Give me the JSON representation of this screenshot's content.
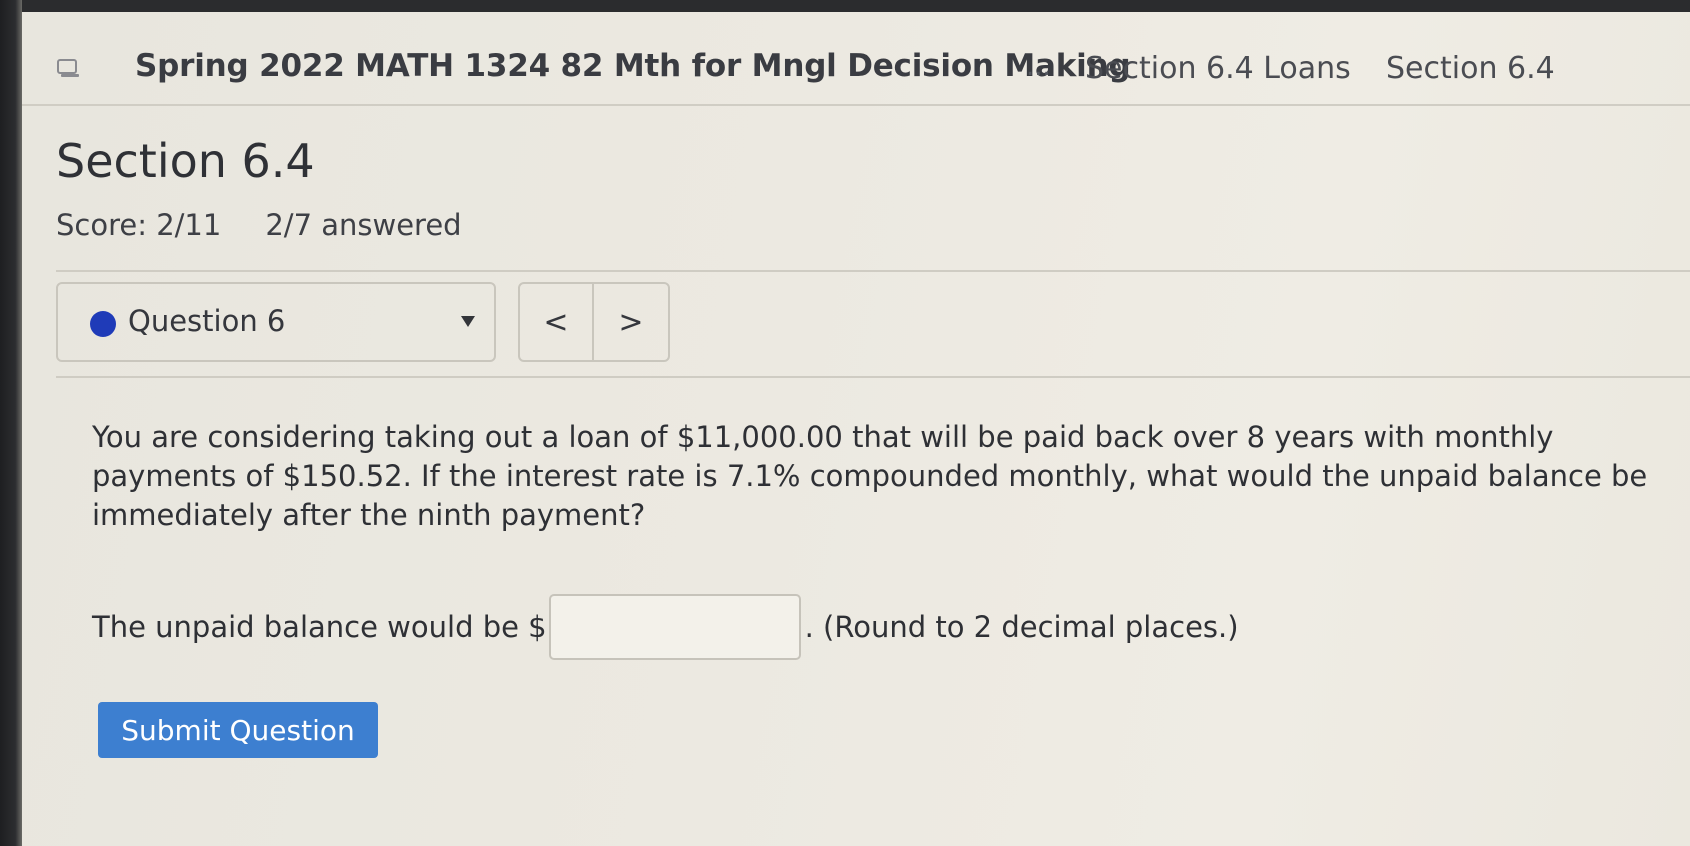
{
  "breadcrumb": {
    "course": "Spring 2022 MATH 1324 82 Mth for Mngl Decision Making",
    "ellipsis": "...",
    "item1": "Section 6.4 Loans",
    "item2": "Section 6.4"
  },
  "section": {
    "title": "Section 6.4",
    "score": "Score: 2/11",
    "answered": "2/7 answered"
  },
  "question_nav": {
    "current": "Question 6",
    "status_color": "#1f3bb8",
    "prev_symbol": "<",
    "next_symbol": ">"
  },
  "question": {
    "text": "You are considering taking out a loan of $11,000.00 that will be paid back over 8 years with monthly payments of $150.52. If the interest rate is 7.1% compounded monthly, what would the unpaid balance be immediately after the ninth payment?",
    "answer_prefix": "The unpaid balance would be $",
    "answer_value": "",
    "answer_suffix": ". (Round to 2 decimal places.)"
  },
  "submit_label": "Submit Question",
  "colors": {
    "accent": "#3d7fd0"
  }
}
